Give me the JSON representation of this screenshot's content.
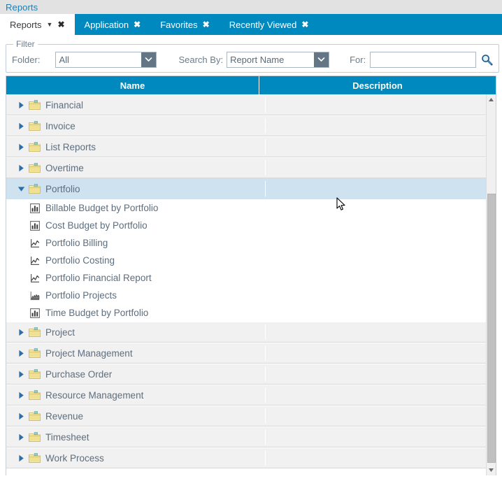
{
  "page": {
    "title": "Reports"
  },
  "tabs": [
    {
      "label": "Reports",
      "active": true,
      "has_caret": true,
      "close": "✖"
    },
    {
      "label": "Application",
      "active": false,
      "has_caret": false,
      "close": "✖"
    },
    {
      "label": "Favorites",
      "active": false,
      "has_caret": false,
      "close": "✖"
    },
    {
      "label": "Recently Viewed",
      "active": false,
      "has_caret": false,
      "close": "✖"
    }
  ],
  "filter": {
    "legend": "Filter",
    "folder_label": "Folder:",
    "folder_value": "All",
    "search_by_label": "Search By:",
    "search_by_value": "Report Name",
    "for_label": "For:",
    "for_value": "",
    "for_placeholder": "",
    "search_icon": "magnifier-icon"
  },
  "grid": {
    "columns": [
      {
        "key": "name",
        "label": "Name"
      },
      {
        "key": "description",
        "label": "Description"
      }
    ],
    "rows": [
      {
        "type": "folder",
        "label": "Financial",
        "expanded": false,
        "selected": false,
        "description": ""
      },
      {
        "type": "folder",
        "label": "Invoice",
        "expanded": false,
        "selected": false,
        "description": ""
      },
      {
        "type": "folder",
        "label": "List Reports",
        "expanded": false,
        "selected": false,
        "description": ""
      },
      {
        "type": "folder",
        "label": "Overtime",
        "expanded": false,
        "selected": false,
        "description": ""
      },
      {
        "type": "folder",
        "label": "Portfolio",
        "expanded": true,
        "selected": true,
        "description": ""
      },
      {
        "type": "child",
        "label": "Billable Budget by Portfolio",
        "icon": "bar-chart-icon",
        "description": ""
      },
      {
        "type": "child",
        "label": "Cost Budget by Portfolio",
        "icon": "bar-chart-icon",
        "description": ""
      },
      {
        "type": "child",
        "label": "Portfolio Billing",
        "icon": "line-chart-icon",
        "description": ""
      },
      {
        "type": "child",
        "label": "Portfolio Costing",
        "icon": "line-chart-icon",
        "description": ""
      },
      {
        "type": "child",
        "label": "Portfolio Financial Report",
        "icon": "line-chart-icon",
        "description": ""
      },
      {
        "type": "child",
        "label": "Portfolio Projects",
        "icon": "area-chart-icon",
        "description": ""
      },
      {
        "type": "child",
        "label": "Time Budget by Portfolio",
        "icon": "bar-chart-icon",
        "description": ""
      },
      {
        "type": "folder",
        "label": "Project",
        "expanded": false,
        "selected": false,
        "description": ""
      },
      {
        "type": "folder",
        "label": "Project Management",
        "expanded": false,
        "selected": false,
        "description": ""
      },
      {
        "type": "folder",
        "label": "Purchase Order",
        "expanded": false,
        "selected": false,
        "description": ""
      },
      {
        "type": "folder",
        "label": "Resource Management",
        "expanded": false,
        "selected": false,
        "description": ""
      },
      {
        "type": "folder",
        "label": "Revenue",
        "expanded": false,
        "selected": false,
        "description": ""
      },
      {
        "type": "folder",
        "label": "Timesheet",
        "expanded": false,
        "selected": false,
        "description": ""
      },
      {
        "type": "folder",
        "label": "Work Process",
        "expanded": false,
        "selected": false,
        "description": ""
      }
    ]
  },
  "colors": {
    "accent_blue": "#0089bf",
    "title_text": "#1a7fb5",
    "row_background": "#f1f1f1",
    "row_selected": "#cfe2f0",
    "folder_icon": "#f2de84",
    "text": "#5d6e7e"
  }
}
